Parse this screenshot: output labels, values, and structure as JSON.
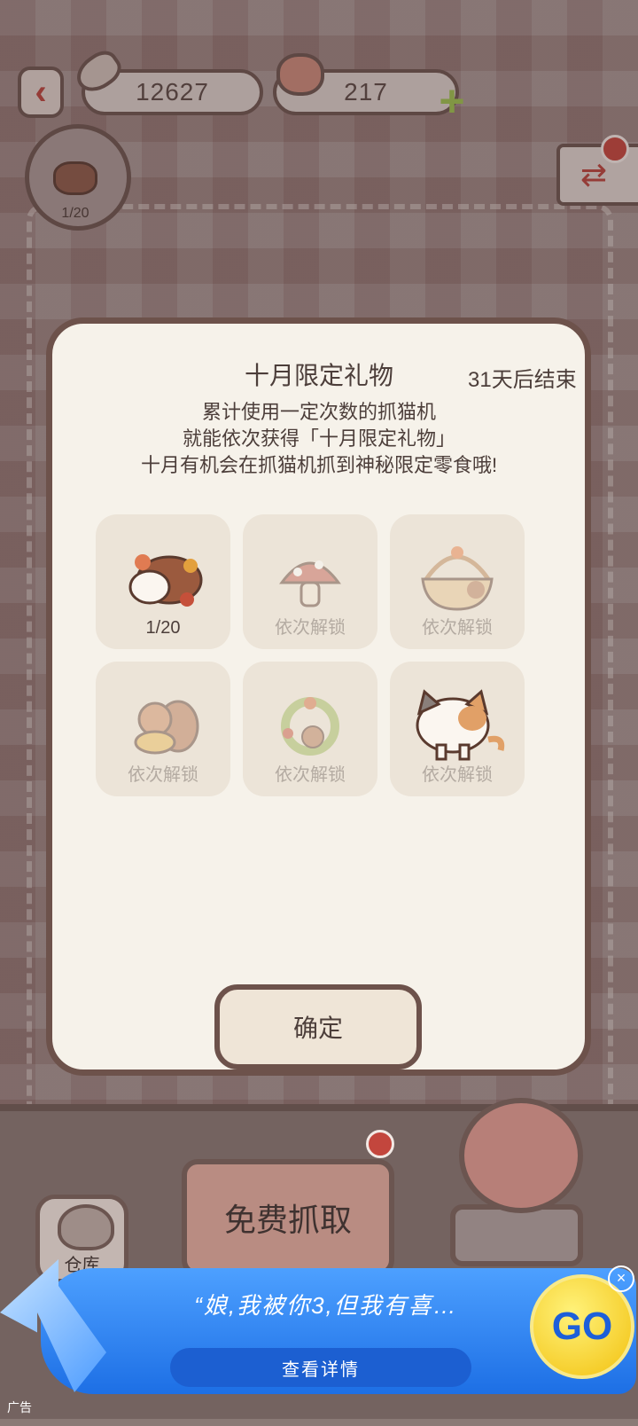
{
  "top_bar": {
    "fish_count": "12627",
    "heart_count": "217"
  },
  "progress_badge": {
    "text": "1/20"
  },
  "modal": {
    "title": "十月限定礼物",
    "countdown": "31天后结束",
    "desc_lines": [
      "累计使用一定次数的抓猫机",
      "就能依次获得「十月限定礼物」",
      "十月有机会在抓猫机抓到神秘限定零食哦!"
    ],
    "rewards": [
      {
        "label": "1/20",
        "active": true,
        "icon": "hamster-leaves-icon"
      },
      {
        "label": "依次解锁",
        "active": false,
        "icon": "mushroom-icon"
      },
      {
        "label": "依次解锁",
        "active": false,
        "icon": "basket-icon"
      },
      {
        "label": "依次解锁",
        "active": false,
        "icon": "squirrel-icon"
      },
      {
        "label": "依次解锁",
        "active": false,
        "icon": "wreath-icon"
      },
      {
        "label": "依次解锁",
        "active": false,
        "icon": "calico-cat-icon"
      }
    ],
    "confirm_label": "确定"
  },
  "controls": {
    "grab_label": "免费抓取",
    "storage_label": "仓库"
  },
  "ad": {
    "text": "“娘,我被你3,但我有喜…",
    "detail_label": "查看详情",
    "go_label": "GO",
    "tag": "广告"
  },
  "colors": {
    "accent_red": "#c3463d",
    "border_brown": "#6d524b",
    "modal_bg": "#f6f2ea",
    "ad_blue": "#1d6fe5"
  }
}
